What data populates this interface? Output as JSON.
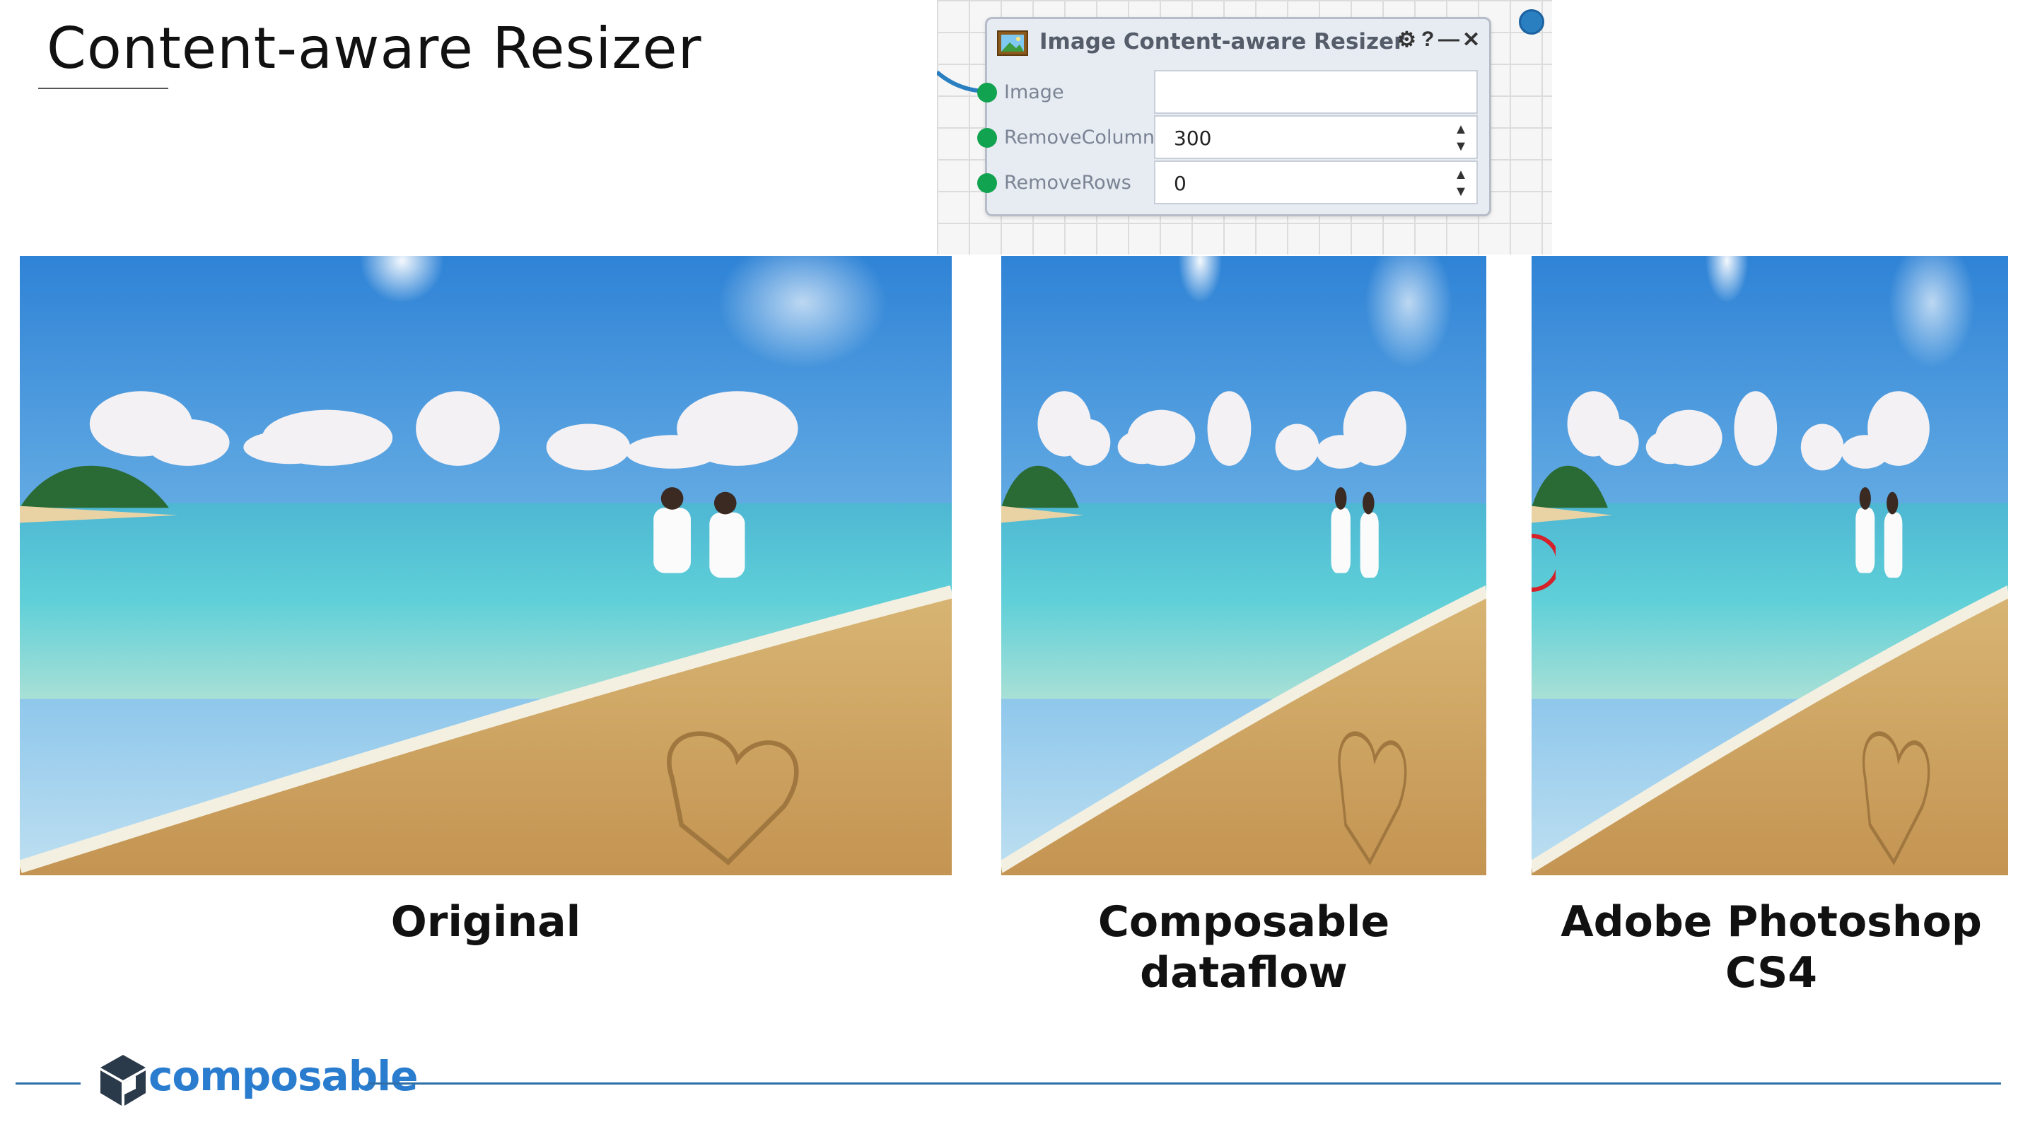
{
  "slide": {
    "title": "Content-aware Resizer"
  },
  "node": {
    "title": "Image Content-aware Resizer",
    "controls": {
      "settings": "⚙",
      "help": "?",
      "minimize": "—",
      "close": "✕"
    },
    "inputs": [
      {
        "label": "Image",
        "value": ""
      },
      {
        "label": "RemoveColumns",
        "value": "300"
      },
      {
        "label": "RemoveRows",
        "value": "0"
      }
    ]
  },
  "captions": {
    "original": "Original",
    "composable_line1": "Composable",
    "composable_line2": "dataflow",
    "photoshop": "Adobe Photoshop CS4"
  },
  "footer": {
    "brand": "composable"
  },
  "colors": {
    "accent": "#2a7ccf",
    "port_green": "#12a350",
    "port_blue": "#2a7fc1"
  }
}
